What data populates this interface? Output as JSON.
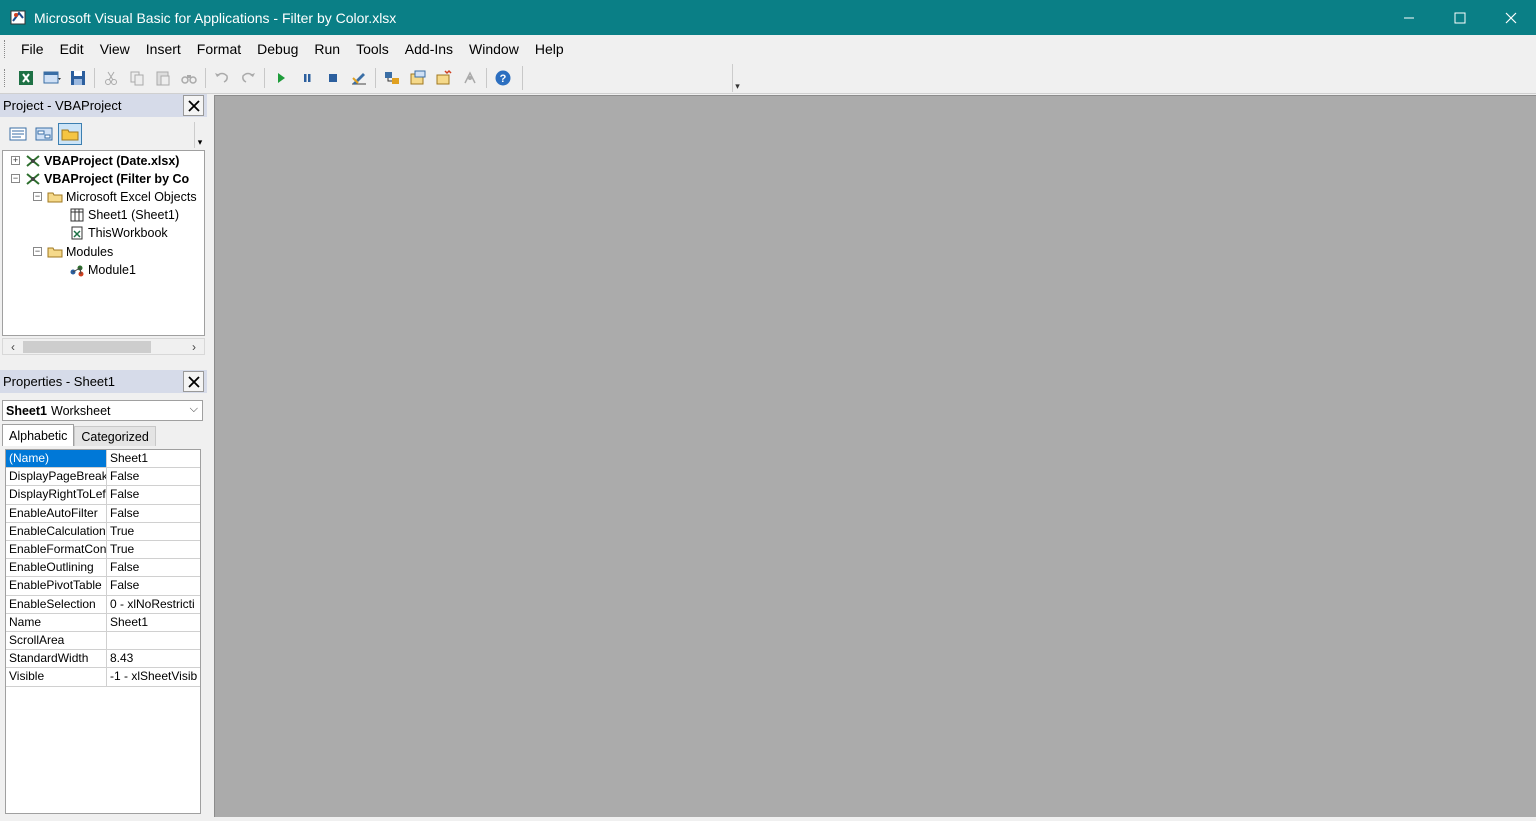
{
  "window": {
    "title": "Microsoft Visual Basic for Applications - Filter by Color.xlsx"
  },
  "menu": [
    "File",
    "Edit",
    "View",
    "Insert",
    "Format",
    "Debug",
    "Run",
    "Tools",
    "Add-Ins",
    "Window",
    "Help"
  ],
  "project_pane": {
    "title": "Project - VBAProject",
    "tree": [
      {
        "label": "VBAProject (Date.xlsx)",
        "expander": "+",
        "bold": true
      },
      {
        "label": "VBAProject (Filter by Co",
        "expander": "-",
        "bold": true
      },
      {
        "label": "Microsoft Excel Objects",
        "expander": "-"
      },
      {
        "label": "Sheet1 (Sheet1)"
      },
      {
        "label": "ThisWorkbook"
      },
      {
        "label": "Modules",
        "expander": "-"
      },
      {
        "label": "Module1"
      }
    ]
  },
  "properties_pane": {
    "title": "Properties - Sheet1",
    "object_name": "Sheet1",
    "object_type": "Worksheet",
    "tabs": [
      "Alphabetic",
      "Categorized"
    ],
    "rows": [
      {
        "name": "(Name)",
        "value": "Sheet1"
      },
      {
        "name": "DisplayPageBreak",
        "value": "False"
      },
      {
        "name": "DisplayRightToLef",
        "value": "False"
      },
      {
        "name": "EnableAutoFilter",
        "value": "False"
      },
      {
        "name": "EnableCalculation",
        "value": "True"
      },
      {
        "name": "EnableFormatCon",
        "value": "True"
      },
      {
        "name": "EnableOutlining",
        "value": "False"
      },
      {
        "name": "EnablePivotTable",
        "value": "False"
      },
      {
        "name": "EnableSelection",
        "value": "0 - xlNoRestricti"
      },
      {
        "name": "Name",
        "value": "Sheet1"
      },
      {
        "name": "ScrollArea",
        "value": ""
      },
      {
        "name": "StandardWidth",
        "value": "8.43"
      },
      {
        "name": "Visible",
        "value": "-1 - xlSheetVisib"
      }
    ]
  },
  "colors": {
    "titlebar": "#0a7f86",
    "pane_title": "#d6dbe9",
    "workspace": "#ababab",
    "selection": "#0078d7"
  },
  "icons": [
    "excel-icon",
    "insert-userform-icon",
    "save-icon",
    "cut-icon",
    "copy-icon",
    "paste-icon",
    "find-icon",
    "undo-icon",
    "redo-icon",
    "run-icon",
    "break-icon",
    "reset-icon",
    "design-mode-icon",
    "project-explorer-icon",
    "properties-window-icon",
    "object-browser-icon",
    "toolbox-icon",
    "help-icon"
  ]
}
